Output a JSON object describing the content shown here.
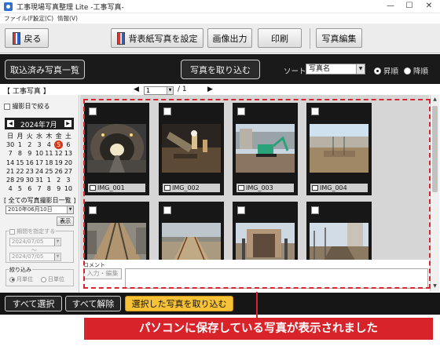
{
  "window": {
    "title": "工事現場写真整理 Lite -工事写真-",
    "minimize": "—",
    "maximize": "☐",
    "close": "✕"
  },
  "menu": [
    "ファイル(F)",
    "設定(C)",
    "情報(V)"
  ],
  "toolbar": {
    "back": "戻る",
    "set_background": "背表紙写真を設定",
    "image_output": "画像出力",
    "print": "印刷",
    "photo_edit": "写真編集"
  },
  "header": {
    "imported_list": "取込済み写真一覧",
    "import_photos": "写真を取り込む",
    "sort_label": "ソート",
    "sort_value": "写真名",
    "ascending": "昇順",
    "descending": "降順",
    "sort_order": "ascending"
  },
  "section_title": "【 工事写真 】",
  "pager": {
    "prev": "◀",
    "next": "▶",
    "current": "1",
    "total": "/ 1"
  },
  "left_panel": {
    "filter_by_date": "撮影日で絞る",
    "calendar": {
      "month": "2024年7月",
      "prev": "◀",
      "next": "▶",
      "weekdays": [
        "日",
        "月",
        "火",
        "水",
        "木",
        "金",
        "土"
      ],
      "days": [
        "30",
        "1",
        "2",
        "3",
        "4",
        "5",
        "6",
        "7",
        "8",
        "9",
        "10",
        "11",
        "12",
        "13",
        "14",
        "15",
        "16",
        "17",
        "18",
        "19",
        "20",
        "21",
        "22",
        "23",
        "24",
        "25",
        "26",
        "27",
        "28",
        "29",
        "30",
        "31",
        "1",
        "2",
        "3",
        "4",
        "5",
        "6",
        "7",
        "8",
        "9",
        "10"
      ],
      "selected_index": 5
    },
    "date_list_label": "[ 全ての写真撮影日一覧 ]",
    "date_list_value": "2010年06月10日",
    "show_button": "表示",
    "period_label": "期間を指定する",
    "period_from": "2024/07/05",
    "period_sep": "〜",
    "period_to": "2024/07/05",
    "narrow_label": "絞り込み",
    "by_month": "月単位",
    "by_day": "日単位"
  },
  "photos": [
    {
      "name": "IMG_001",
      "scene": "tunnel"
    },
    {
      "name": "IMG_002",
      "scene": "excavation"
    },
    {
      "name": "IMG_003",
      "scene": "excavator"
    },
    {
      "name": "IMG_004",
      "scene": "site"
    },
    {
      "name": "",
      "scene": "rails"
    },
    {
      "name": "",
      "scene": "rebar"
    },
    {
      "name": "",
      "scene": "gate"
    },
    {
      "name": "",
      "scene": "trench"
    }
  ],
  "comment": {
    "label": "コメント",
    "edit_button": "入力・編集"
  },
  "footer": {
    "select_all": "すべて選択",
    "deselect_all": "すべて解除",
    "import_selected": "選択した写真を取り込む"
  },
  "banner": "パソコンに保存している写真が表示されました",
  "colors": {
    "accent_red": "#d8232a",
    "import_yellow": "#f7c236",
    "dark_band": "#1a1a1a"
  }
}
